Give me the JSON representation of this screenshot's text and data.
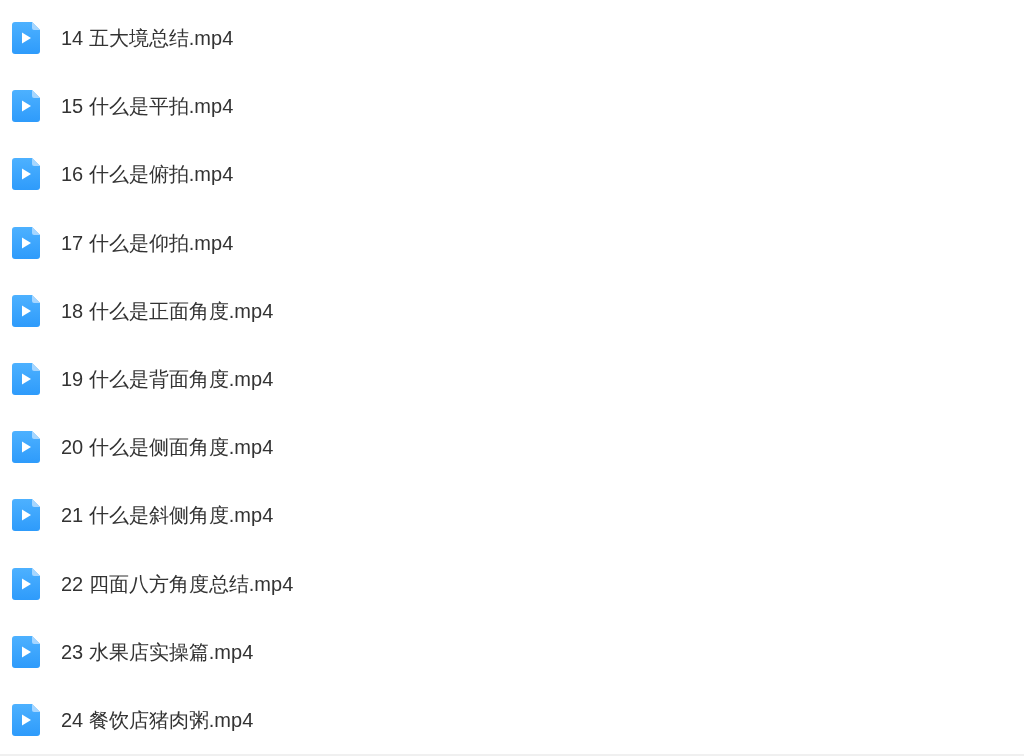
{
  "files": [
    {
      "name": "14 五大境总结.mp4"
    },
    {
      "name": "15 什么是平拍.mp4"
    },
    {
      "name": "16 什么是俯拍.mp4"
    },
    {
      "name": "17 什么是仰拍.mp4"
    },
    {
      "name": "18 什么是正面角度.mp4"
    },
    {
      "name": "19 什么是背面角度.mp4"
    },
    {
      "name": "20 什么是侧面角度.mp4"
    },
    {
      "name": "21 什么是斜侧角度.mp4"
    },
    {
      "name": "22 四面八方角度总结.mp4"
    },
    {
      "name": "23 水果店实操篇.mp4"
    },
    {
      "name": "24 餐饮店猪肉粥.mp4"
    }
  ]
}
